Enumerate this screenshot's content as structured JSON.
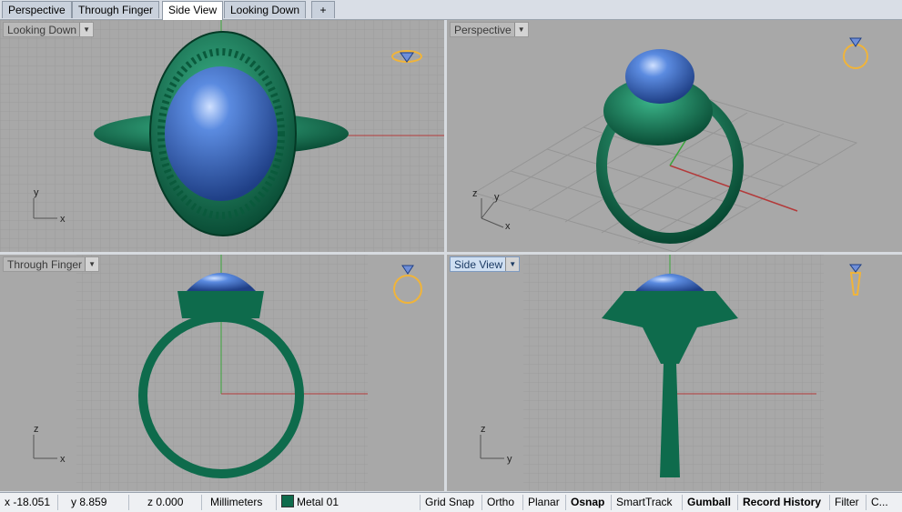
{
  "tabs": [
    {
      "label": "Perspective"
    },
    {
      "label": "Through Finger"
    },
    {
      "label": "Side View"
    },
    {
      "label": "Looking Down"
    },
    {
      "label": "+"
    }
  ],
  "viewports": {
    "top_left": {
      "title": "Looking Down",
      "axis_v": "y",
      "axis_h": "x"
    },
    "top_right": {
      "title": "Perspective",
      "axis_v": "z",
      "axis_y": "y",
      "axis_h": "x"
    },
    "bottom_left": {
      "title": "Through Finger",
      "axis_v": "z",
      "axis_h": "x"
    },
    "bottom_right": {
      "title": "Side View",
      "axis_v": "z",
      "axis_h": "y"
    }
  },
  "status": {
    "x": "x -18.051",
    "y": "y 8.859",
    "z": "z 0.000",
    "units": "Millimeters",
    "layer": "Metal 01",
    "grid_snap": "Grid Snap",
    "ortho": "Ortho",
    "planar": "Planar",
    "osnap": "Osnap",
    "smarttrack": "SmartTrack",
    "gumball": "Gumball",
    "record_history": "Record History",
    "filter": "Filter",
    "more": "C..."
  },
  "colors": {
    "metal": "#0e6b4c",
    "gem": "#3d6fc4",
    "viewport_bg": "#a8a8a8",
    "grid": "#9c9c9c",
    "x_axis": "#b33a3a",
    "y_axis": "#3aa63a",
    "widget": "#f0b43a"
  }
}
